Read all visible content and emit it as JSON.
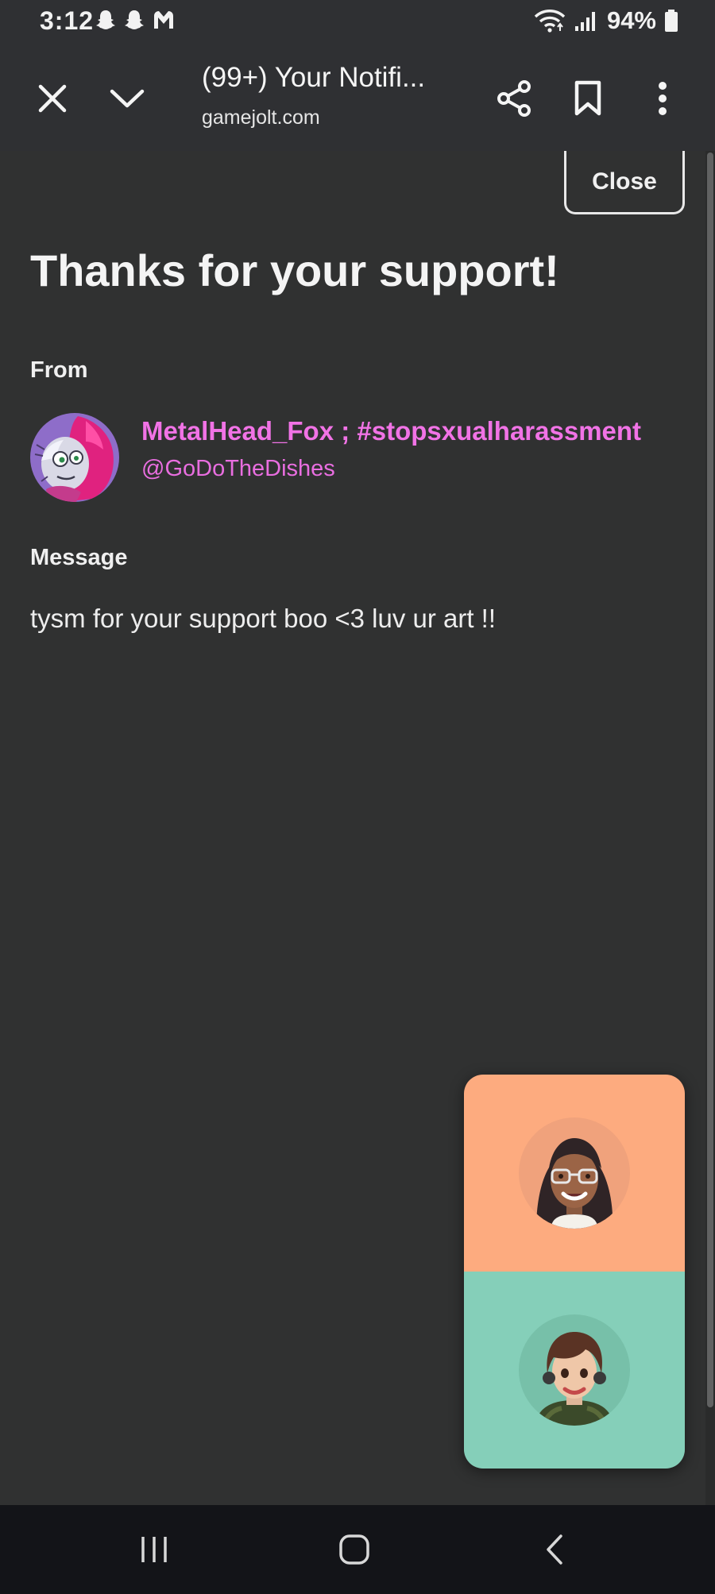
{
  "status_bar": {
    "time": "3:12",
    "battery": "94%",
    "left_icons": [
      "snapchat-icon",
      "snapchat-icon",
      "malwarebytes-icon"
    ],
    "right_icons": [
      "wifi-icon",
      "signal-icon",
      "battery-icon"
    ]
  },
  "toolbar": {
    "title": "(99+) Your Notifi...",
    "url": "gamejolt.com",
    "icons": [
      "close-icon",
      "chevron-down-icon",
      "share-icon",
      "bookmark-icon",
      "more-vert-icon"
    ]
  },
  "page": {
    "close_label": "Close",
    "heading": "Thanks for your support!",
    "from_label": "From",
    "user": {
      "name": "MetalHead_Fox ; #stopsxualharassment",
      "handle": "@GoDoTheDishes"
    },
    "message_label": "Message",
    "message": "tysm for your support boo <3 luv ur art !!"
  },
  "call_panel": {
    "top_color": "#fdab7f",
    "bottom_color": "#85cfb9"
  },
  "colors": {
    "accent_pink": "#f173e6",
    "background": "#303131",
    "toolbar": "#2f3033"
  }
}
